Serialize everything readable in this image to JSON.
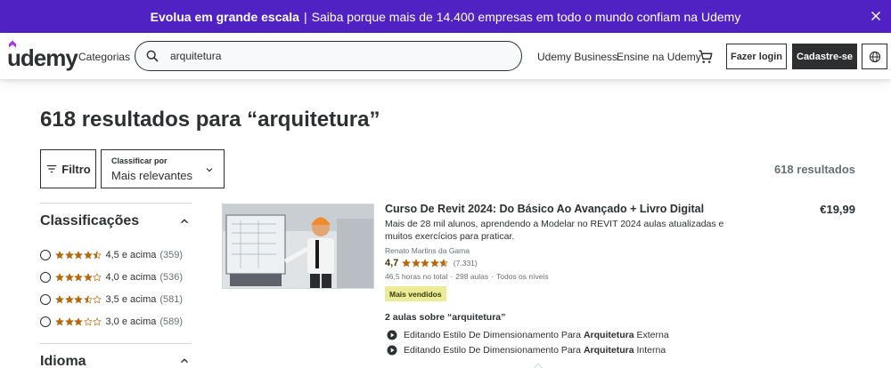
{
  "banner": {
    "bold": "Evolua em grande escala",
    "separator": "|",
    "text": "Saiba porque mais de 14.400 empresas em todo o mundo confiam na Udemy"
  },
  "header": {
    "logo": "udemy",
    "categories": "Categorias",
    "search_value": "arquitetura",
    "business": "Udemy Business",
    "teach": "Ensine na Udemy",
    "login": "Fazer login",
    "signup": "Cadastre-se"
  },
  "main": {
    "title": "618 resultados para “arquitetura”",
    "filter_label": "Filtro",
    "sort_label": "Classificar por",
    "sort_value": "Mais relevantes",
    "result_count": "618 resultados"
  },
  "sidebar": {
    "ratings_heading": "Classificações",
    "ratings": [
      {
        "stars": 4.5,
        "label": "4,5 e acima",
        "count": "(359)"
      },
      {
        "stars": 4.0,
        "label": "4,0 e acima",
        "count": "(536)"
      },
      {
        "stars": 3.5,
        "label": "3,5 e acima",
        "count": "(581)"
      },
      {
        "stars": 3.0,
        "label": "3,0 e acima",
        "count": "(589)"
      }
    ],
    "language_heading": "Idioma"
  },
  "course": {
    "title": "Curso De Revit 2024: Do Básico Ao Avançado + Livro Digital",
    "description": "Mais de 28 mil alunos, aprendendo a Modelar no REVIT 2024 aulas atualizadas e muitos exercícios para praticar.",
    "instructor": "Renato Martins da Gama",
    "rating": "4,7",
    "rating_value": 4.7,
    "reviews": "(7.331)",
    "hours": "46,5 horas no total",
    "lectures": "298 aulas",
    "level": "Todos os níveis",
    "badge": "Mais vendidos",
    "price": "€19,99",
    "lessons_heading": "2 aulas sobre “arquitetura”",
    "lessons": [
      {
        "prefix": "Editando Estilo De Dimensionamento Para",
        "bold": "Arquitetura",
        "suffix": "Externa"
      },
      {
        "prefix": "Editando Estilo De Dimensionamento Para",
        "bold": "Arquitetura",
        "suffix": "Interna"
      }
    ]
  },
  "colors": {
    "banner": "#5022c3",
    "star": "#b4690e",
    "dark": "#2d2f31",
    "badge": "#eceb98",
    "udemy_purple": "#a435f0"
  }
}
